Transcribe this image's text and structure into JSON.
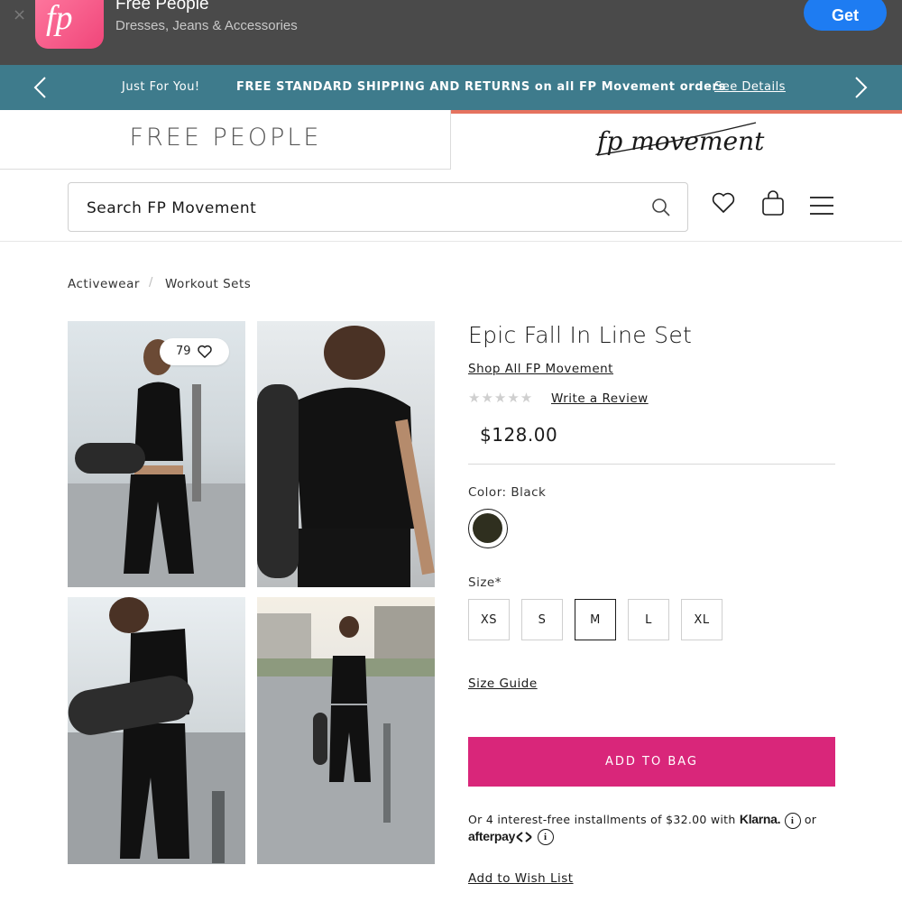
{
  "app_banner": {
    "close_glyph": "×",
    "app_name": "Free People",
    "app_subtitle": "Dresses, Jeans & Accessories",
    "get_label": "Get",
    "icon": "fp-app-logo",
    "icon_text": "fp"
  },
  "promo": {
    "left_text": "Just For You!",
    "main_text": "FREE STANDARD SHIPPING AND RETURNS on all FP Movement orders",
    "link_text": "See Details",
    "color": "#3e7b8c"
  },
  "brands": {
    "left": "FREE PEOPLE",
    "right": "fp movement"
  },
  "search": {
    "placeholder": "Search FP Movement"
  },
  "breadcrumb": {
    "items": [
      "Activewear",
      "Workout Sets"
    ],
    "separator": "/"
  },
  "gallery": {
    "like_count": "79"
  },
  "product": {
    "title": "Epic Fall In Line Set",
    "shop_all": "Shop All FP Movement",
    "stars": "★★★★★",
    "rating": 0,
    "write_review": "Write a Review",
    "price": "$128.00",
    "color_label": "Color: Black",
    "swatch_color": "#2f2f1f",
    "size_label": "Size*",
    "sizes": [
      "XS",
      "S",
      "M",
      "L",
      "XL"
    ],
    "selected_size": "M",
    "size_guide": "Size Guide",
    "add_to_bag": "ADD TO BAG",
    "add_to_bag_color": "#d9267a",
    "installments_text": "Or 4 interest-free installments of $32.00 with",
    "klarna": "Klarna.",
    "or": "or",
    "afterpay": "afterpay",
    "info_glyph": "i",
    "wish_list": "Add to Wish List"
  }
}
